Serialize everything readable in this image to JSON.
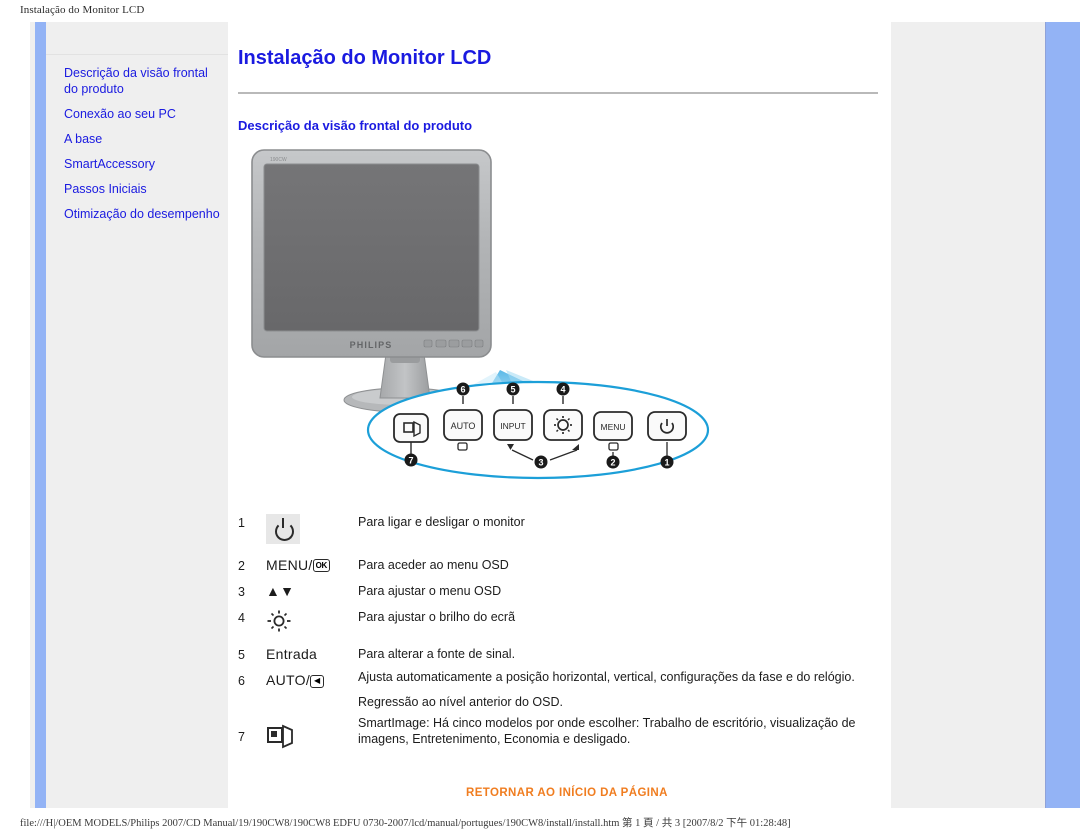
{
  "browser": {
    "print_header": "Instalação do Monitor LCD",
    "status_path": "file:///H|/OEM MODELS/Philips 2007/CD Manual/19/190CW8/190CW8 EDFU 0730-2007/lcd/manual/portugues/190CW8/install/install.htm 第 1 頁 / 共 3 [2007/8/2 下午 01:28:48]"
  },
  "colors": {
    "link_blue": "#1a1ae0",
    "stripe_blue": "#93b3f5",
    "sidebar_grey": "#efefef",
    "accent_orange": "#f07d20",
    "monitor_bezel": "#b0b2b4",
    "monitor_screen": "#6e6e70",
    "callout_blue": "#1c9fd8"
  },
  "sidebar": {
    "items": [
      {
        "label": "Descrição da visão frontal do produto"
      },
      {
        "label": "Conexão ao seu PC"
      },
      {
        "label": "A base"
      },
      {
        "label": "SmartAccessory"
      },
      {
        "label": "Passos Iniciais"
      },
      {
        "label": "Otimização do desempenho"
      }
    ]
  },
  "content": {
    "title": "Instalação do Monitor LCD",
    "section_title": "Descrição da visão frontal do produto",
    "footer_link": "RETORNAR AO INÍCIO DA PÁGINA"
  },
  "figure": {
    "brand": "PHILIPS",
    "model_mark": "190CW",
    "callout_buttons": [
      {
        "label": "AUTO",
        "number": "6"
      },
      {
        "label": "INPUT",
        "number": "5"
      },
      {
        "label": "brightness-icon",
        "number": "4"
      },
      {
        "label": "MENU",
        "number": "2"
      },
      {
        "label": "power-icon",
        "number": "1"
      },
      {
        "label": "smartimage-icon",
        "number": "7"
      },
      {
        "label": "up-down-arrows",
        "number": "3"
      }
    ]
  },
  "controls": [
    {
      "number": "1",
      "icon": "power-icon",
      "icon_text": "",
      "description": "Para ligar e desligar o monitor",
      "extra": ""
    },
    {
      "number": "2",
      "icon": "menu-ok-icon",
      "icon_text": "MENU/",
      "description": "Para aceder ao menu OSD",
      "extra": ""
    },
    {
      "number": "3",
      "icon": "up-down-arrow-icon",
      "icon_text": "▲▼",
      "description": "Para ajustar o menu OSD",
      "extra": ""
    },
    {
      "number": "4",
      "icon": "brightness-icon",
      "icon_text": "",
      "description": "Para ajustar o brilho do ecrã",
      "extra": ""
    },
    {
      "number": "5",
      "icon": "",
      "icon_text": "Entrada",
      "description": "Para alterar a fonte de sinal.",
      "extra": ""
    },
    {
      "number": "6",
      "icon": "auto-left-icon",
      "icon_text": "AUTO/",
      "description": "Ajusta automaticamente a posição horizontal, vertical, configurações da fase e do relógio.",
      "extra": "Regressão ao nível anterior do OSD."
    },
    {
      "number": "7",
      "icon": "smartimage-icon",
      "icon_text": "",
      "description": "SmartImage: Há cinco modelos por onde escolher: Trabalho de escritório, visualização de imagens, Entretenimento, Economia e desligado.",
      "extra": ""
    }
  ]
}
